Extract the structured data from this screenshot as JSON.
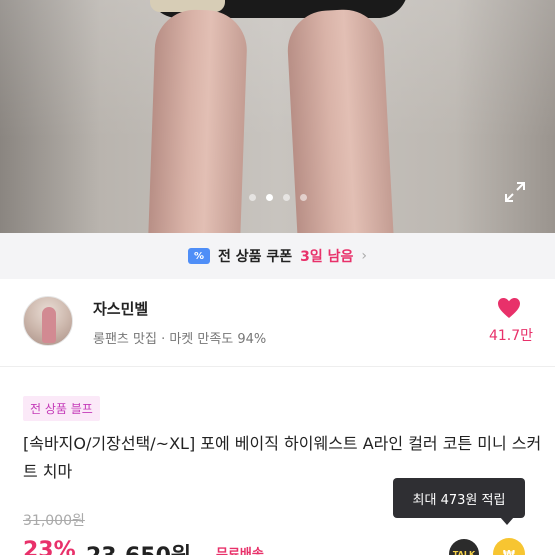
{
  "hero": {
    "image_alt": "",
    "dot_count": 4,
    "active_dot": 1
  },
  "coupon": {
    "icon": "%",
    "text": "전 상품 쿠폰",
    "days": "3일 남음",
    "chevron": "›"
  },
  "shop": {
    "name": "자스민벨",
    "meta": "롱팬츠 맛집 · 마켓 만족도 94%",
    "likes": "41.7만",
    "heart_color": "#e8316a"
  },
  "product": {
    "badge": "전 상품 블프",
    "title": "[속바지O/기장선택/~XL] 포에 베이직 하이웨스트 A라인 컬러 코튼 미니 스커트 치마",
    "original_price": "31,000원",
    "discount": "23%",
    "price": "23,650원",
    "shipping": "무료배송",
    "reward_tooltip": "최대 473원 적립",
    "talk_label": "TALK",
    "coin_label": "₩"
  },
  "colors": {
    "accent": "#e8316a",
    "badge_text": "#c43bb8",
    "badge_bg": "#fbe9f8"
  }
}
